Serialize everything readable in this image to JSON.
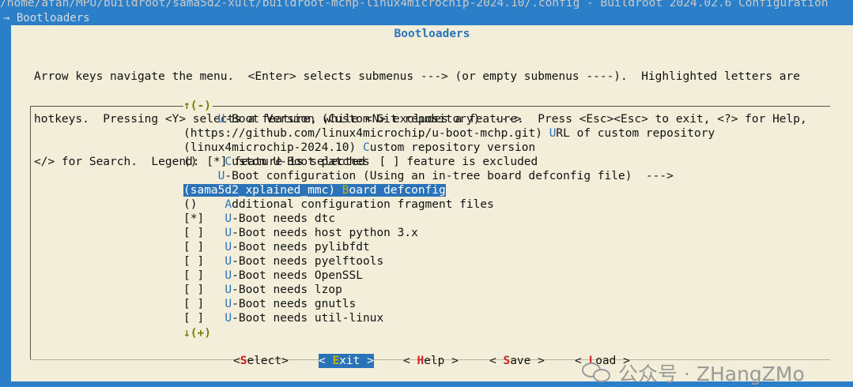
{
  "window": {
    "title": "/home/afan/MPU/buildroot/sama5d2-xult/buildroot-mchp-linux4microchip-2024.10/.config - Buildroot 2024.02.6 Configuration",
    "breadcrumb": "→ Bootloaders"
  },
  "dialog": {
    "title": "Bootloaders",
    "help_lines": [
      "Arrow keys navigate the menu.  <Enter> selects submenus ---> (or empty submenus ----).  Highlighted letters are",
      "hotkeys.  Pressing <Y> selects a feature, while <N> excludes a feature.  Press <Esc><Esc> to exit, <?> for Help,",
      "</> for Search.  Legend: [*] feature is selected  [ ] feature is excluded"
    ],
    "scroll_up": "↑(-)",
    "scroll_down": "↓(+)"
  },
  "menu": {
    "items": [
      {
        "prefix": "     ",
        "hot": "U",
        "rest": "-Boot Version (Custom Git repository)  --->"
      },
      {
        "prefix": "(https://github.com/linux4microchip/u-boot-mchp.git) ",
        "hot": "U",
        "rest": "RL of custom repository"
      },
      {
        "prefix": "(linux4microchip-2024.10) ",
        "hot": "C",
        "rest": "ustom repository version"
      },
      {
        "prefix": "()    ",
        "hot": "C",
        "rest": "ustom U-Boot patches"
      },
      {
        "prefix": "     ",
        "hot": "U",
        "rest": "-Boot configuration (Using an in-tree board defconfig file)  --->"
      },
      {
        "prefix": "(sama5d2_xplained_mmc) ",
        "hot": "B",
        "rest": "oard defconfig"
      },
      {
        "prefix": "()    ",
        "hot": "A",
        "rest": "dditional configuration fragment files"
      },
      {
        "prefix": "[*]   ",
        "hot": "U",
        "rest": "-Boot needs dtc"
      },
      {
        "prefix": "[ ]   ",
        "hot": "U",
        "rest": "-Boot needs host python 3.x"
      },
      {
        "prefix": "[ ]   ",
        "hot": "U",
        "rest": "-Boot needs pylibfdt"
      },
      {
        "prefix": "[ ]   ",
        "hot": "U",
        "rest": "-Boot needs pyelftools"
      },
      {
        "prefix": "[ ]   ",
        "hot": "U",
        "rest": "-Boot needs OpenSSL"
      },
      {
        "prefix": "[ ]   ",
        "hot": "U",
        "rest": "-Boot needs lzop"
      },
      {
        "prefix": "[ ]   ",
        "hot": "U",
        "rest": "-Boot needs gnutls"
      },
      {
        "prefix": "[ ]   ",
        "hot": "U",
        "rest": "-Boot needs util-linux"
      }
    ],
    "selected_index": 5
  },
  "buttons": [
    {
      "pre": "<",
      "hk": "S",
      "post": "elect>"
    },
    {
      "pre": "< ",
      "hk": "E",
      "post": "xit >"
    },
    {
      "pre": "< ",
      "hk": "H",
      "post": "elp >"
    },
    {
      "pre": "< ",
      "hk": "S",
      "post": "ave >"
    },
    {
      "pre": "< ",
      "hk": "L",
      "post": "oad >"
    }
  ],
  "active_button": 1,
  "watermark": {
    "text": "公众号 · ZHangZMo",
    "icon": "wechat-icon"
  },
  "colors": {
    "background": "#2b7fc8",
    "dialog": "#f3eed9",
    "accent": "#2b73b8",
    "hotkey_button": "#cc2222",
    "hotkey_selected": "#c8b400"
  }
}
